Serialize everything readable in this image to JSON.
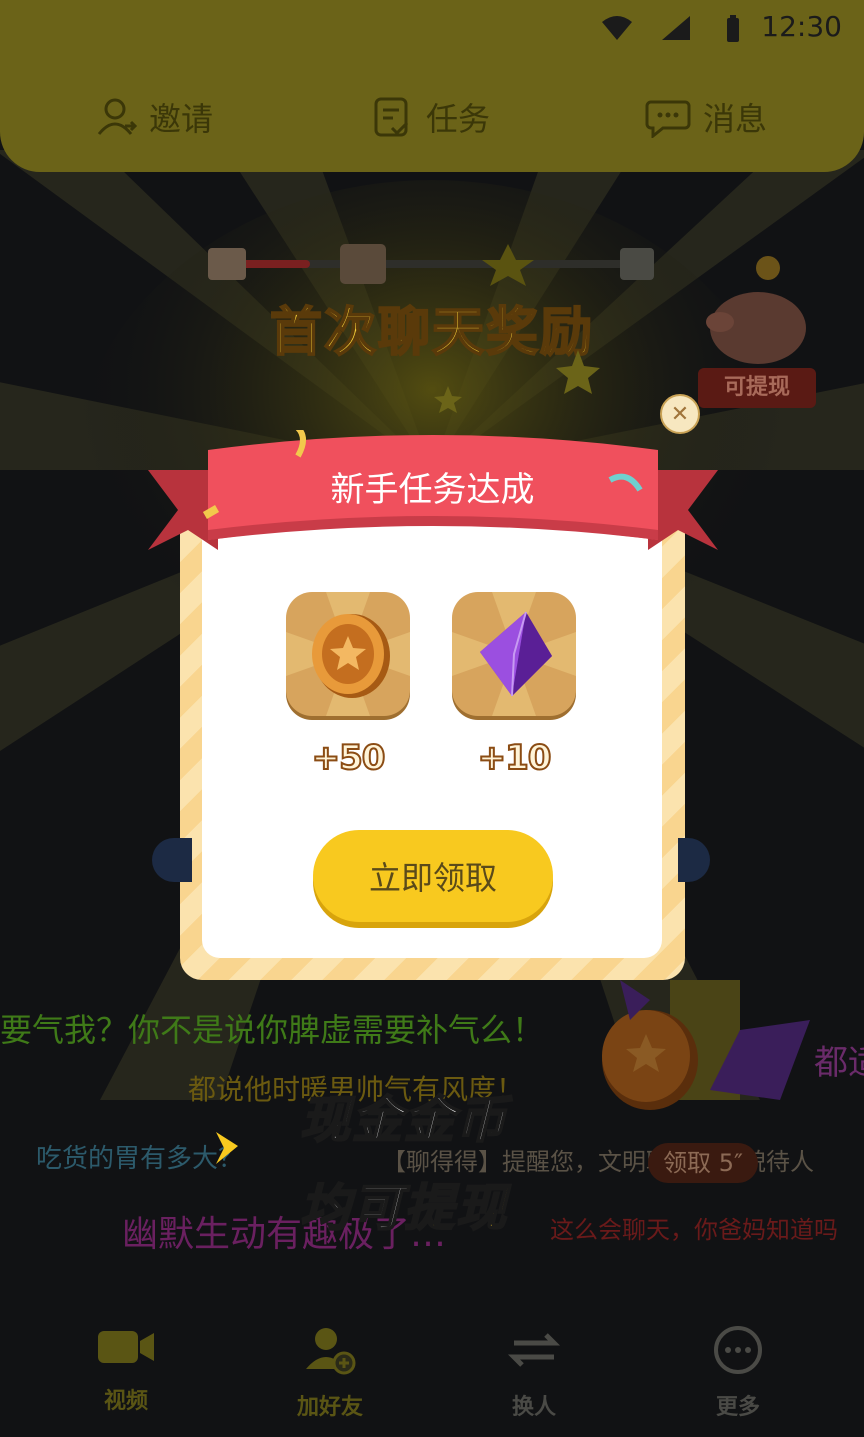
{
  "status_bar": {
    "time": "12:30"
  },
  "top_nav": {
    "invite": "邀请",
    "tasks": "任务",
    "messages": "消息"
  },
  "piggy_badge": "可提现",
  "modal": {
    "heading": "首次聊天奖励",
    "ribbon_title": "新手任务达成",
    "rewards": [
      {
        "icon": "coin-icon",
        "amount": "+50"
      },
      {
        "icon": "gem-icon",
        "amount": "+10"
      }
    ],
    "claim_label": "立即领取"
  },
  "danmaku": [
    {
      "text": "要气我？你不是说你脾虚需要补气么！",
      "color": "#3f7a18"
    },
    {
      "text": "都说他时暖男帅气有风度！",
      "color": "#6b5a10"
    },
    {
      "text": "都适",
      "color": "#6a2b6a"
    },
    {
      "text": "吃货的胃有多大？",
      "color": "#2c5a6b"
    },
    {
      "text": "【聊得得】提醒您，文明聊天，礼貌待人",
      "color": "#5a5246"
    },
    {
      "text": "幽默生动有趣极了…",
      "color": "#6a2060"
    },
    {
      "text": "这么会聊天，你爸妈知道吗",
      "color": "#6a1a1a"
    }
  ],
  "promo": {
    "line1": "现金金币",
    "line2a": "均可",
    "line2b": "提现"
  },
  "claim_countdown": "领取 5″",
  "bottom_nav": {
    "video": "视频",
    "add_friend": "加好友",
    "switch": "换人",
    "more": "更多"
  },
  "colors": {
    "accent": "#f8c91f",
    "ribbon": "#f0505d",
    "overlay_bg": "#111214"
  }
}
